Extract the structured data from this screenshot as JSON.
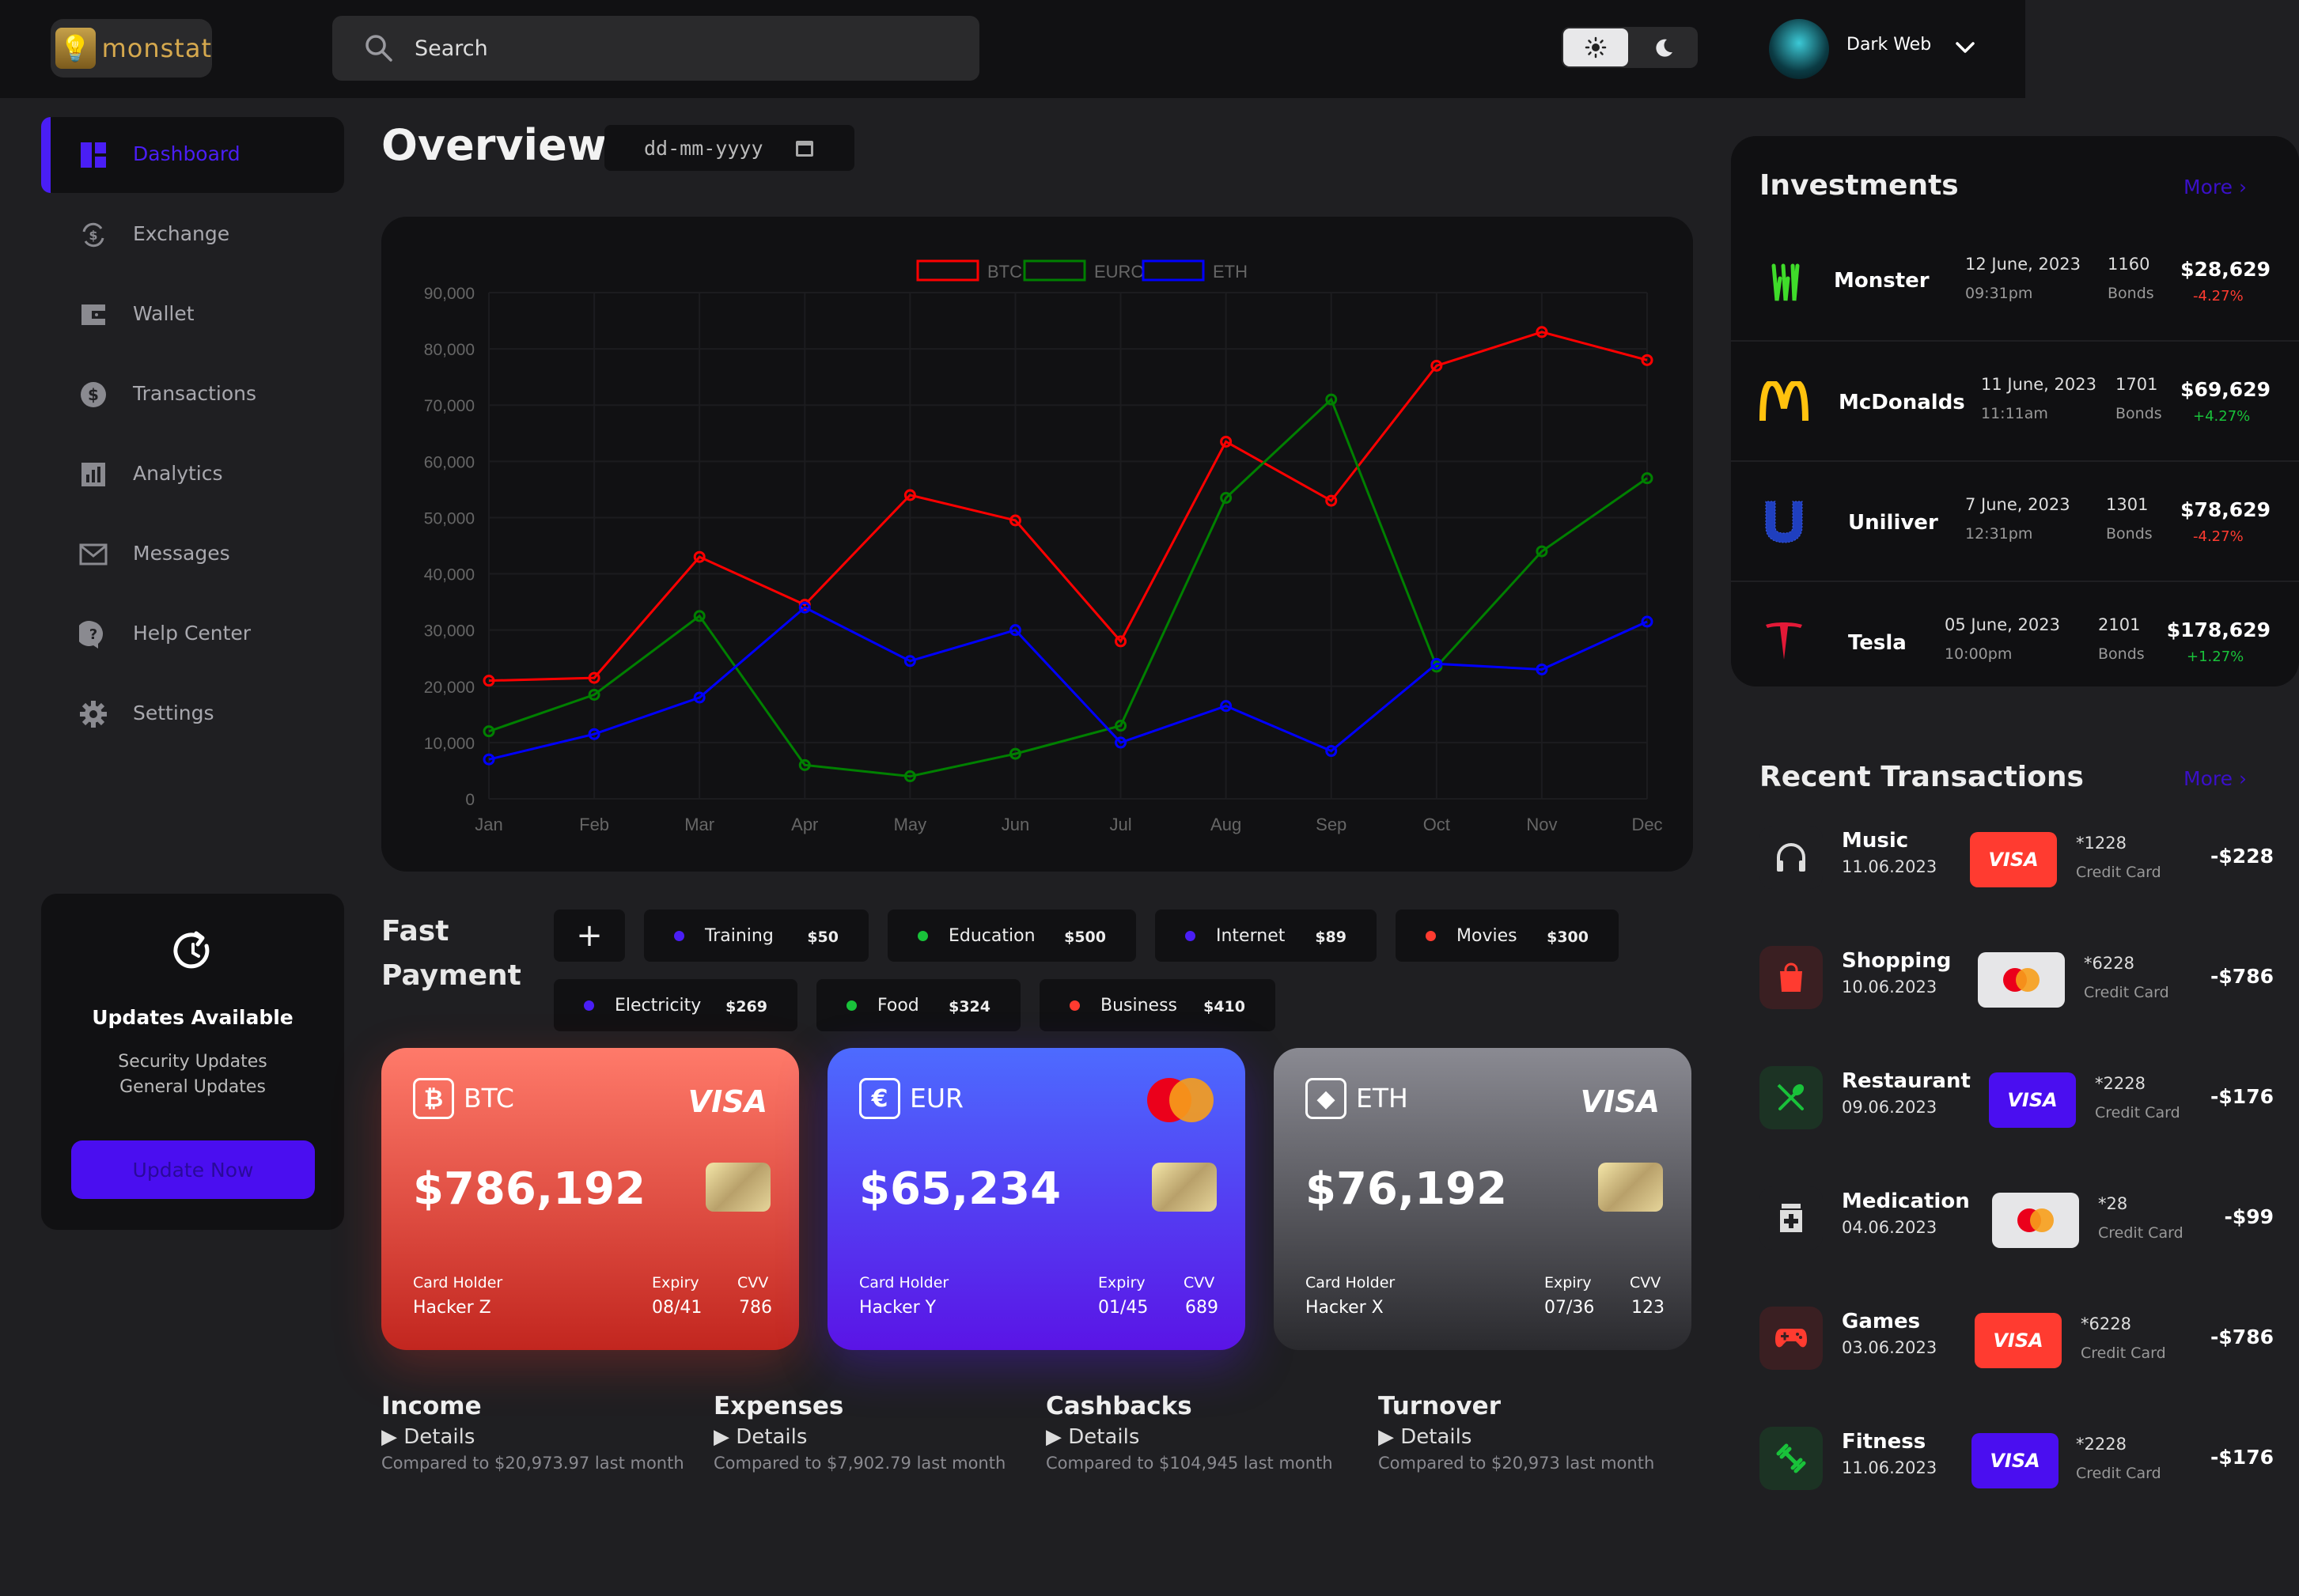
{
  "app": {
    "name": "monstat"
  },
  "search": {
    "placeholder": "Search"
  },
  "user": {
    "name": "Dark Web"
  },
  "theme": {
    "light_icon": "sun-icon",
    "dark_icon": "moon-icon"
  },
  "sidebar": {
    "items": [
      {
        "label": "Dashboard",
        "icon": "dashboard-icon",
        "active": true
      },
      {
        "label": "Exchange",
        "icon": "exchange-icon"
      },
      {
        "label": "Wallet",
        "icon": "wallet-icon"
      },
      {
        "label": "Transactions",
        "icon": "dollar-icon"
      },
      {
        "label": "Analytics",
        "icon": "analytics-icon"
      },
      {
        "label": "Messages",
        "icon": "mail-icon"
      },
      {
        "label": "Help Center",
        "icon": "help-icon"
      },
      {
        "label": "Settings",
        "icon": "gear-icon"
      }
    ],
    "updates": {
      "title": "Updates Available",
      "line1": "Security Updates",
      "line2": "General Updates",
      "button": "Update Now"
    }
  },
  "overview": {
    "title": "Overview",
    "date_placeholder": "dd-mm-yyyy"
  },
  "chart_data": {
    "type": "line",
    "x": [
      "Jan",
      "Feb",
      "Mar",
      "Apr",
      "May",
      "Jun",
      "Jul",
      "Aug",
      "Sep",
      "Oct",
      "Nov",
      "Dec"
    ],
    "ylim": [
      0,
      90000
    ],
    "yticks": [
      "0",
      "10,000",
      "20,000",
      "30,000",
      "40,000",
      "50,000",
      "60,000",
      "70,000",
      "80,000",
      "90,000"
    ],
    "legend": "top-center",
    "series": [
      {
        "name": "BTC",
        "color": "#ff0000",
        "values": [
          21000,
          21500,
          43000,
          34500,
          54000,
          49500,
          28000,
          63500,
          53000,
          77000,
          83000,
          78000
        ]
      },
      {
        "name": "EURO",
        "color": "#008000",
        "values": [
          12000,
          18500,
          32500,
          6000,
          4000,
          8000,
          13000,
          53500,
          71000,
          23500,
          44000,
          57000
        ]
      },
      {
        "name": "ETH",
        "color": "#0000ff",
        "values": [
          7000,
          11500,
          18000,
          34000,
          24500,
          30000,
          10000,
          16500,
          8500,
          24000,
          23000,
          31500
        ]
      }
    ]
  },
  "fast_payment": {
    "title_line1": "Fast",
    "title_line2": "Payment",
    "add_label": "+",
    "row1": [
      {
        "name": "Training",
        "amount": "$50",
        "color": "#4a1ef5"
      },
      {
        "name": "Education",
        "amount": "$500",
        "color": "#19c23a"
      },
      {
        "name": "Internet",
        "amount": "$89",
        "color": "#4a1ef5"
      },
      {
        "name": "Movies",
        "amount": "$300",
        "color": "#ff3b30"
      }
    ],
    "row2": [
      {
        "name": "Electricity",
        "amount": "$269",
        "color": "#4a1ef5"
      },
      {
        "name": "Food",
        "amount": "$324",
        "color": "#19c23a"
      },
      {
        "name": "Business",
        "amount": "$410",
        "color": "#ff3b30"
      }
    ]
  },
  "cards": [
    {
      "currency": "BTC",
      "symbol": "₿",
      "balance": "$786,192",
      "brand": "VISA",
      "holder_label": "Card Holder",
      "holder": "Hacker Z",
      "expiry_label": "Expiry",
      "expiry": "08/41",
      "cvv_label": "CVV",
      "cvv": "786"
    },
    {
      "currency": "EUR",
      "symbol": "€",
      "balance": "$65,234",
      "brand": "mastercard",
      "holder_label": "Card Holder",
      "holder": "Hacker Y",
      "expiry_label": "Expiry",
      "expiry": "01/45",
      "cvv_label": "CVV",
      "cvv": "689"
    },
    {
      "currency": "ETH",
      "symbol": "◆",
      "balance": "$76,192",
      "brand": "VISA",
      "holder_label": "Card Holder",
      "holder": "Hacker X",
      "expiry_label": "Expiry",
      "expiry": "07/36",
      "cvv_label": "CVV",
      "cvv": "123"
    }
  ],
  "summaries": [
    {
      "title": "Income",
      "details": "Details",
      "compare": "Compared to $20,973.97 last month"
    },
    {
      "title": "Expenses",
      "details": "Details",
      "compare": "Compared to $7,902.79 last month"
    },
    {
      "title": "Cashbacks",
      "details": "Details",
      "compare": "Compared to $104,945 last month"
    },
    {
      "title": "Turnover",
      "details": "Details",
      "compare": "Compared to $20,973 last month"
    }
  ],
  "investments": {
    "title": "Investments",
    "more": "More",
    "rows": [
      {
        "name": "Monster",
        "date": "12 June, 2023",
        "time": "09:31pm",
        "qty": "1160",
        "unit": "Bonds",
        "amount": "$28,629",
        "change": "-4.27%",
        "change_color": "#ff3b30",
        "logo": "monster-logo-icon"
      },
      {
        "name": "McDonalds",
        "date": "11 June, 2023",
        "time": "11:11am",
        "qty": "1701",
        "unit": "Bonds",
        "amount": "$69,629",
        "change": "+4.27%",
        "change_color": "#19c23a",
        "logo": "mcdonalds-logo-icon"
      },
      {
        "name": "Uniliver",
        "date": "7 June, 2023",
        "time": "12:31pm",
        "qty": "1301",
        "unit": "Bonds",
        "amount": "$78,629",
        "change": "-4.27%",
        "change_color": "#ff3b30",
        "logo": "unilever-logo-icon"
      },
      {
        "name": "Tesla",
        "date": "05 June, 2023",
        "time": "10:00pm",
        "qty": "2101",
        "unit": "Bonds",
        "amount": "$178,629",
        "change": "+1.27%",
        "change_color": "#19c23a",
        "logo": "tesla-logo-icon"
      }
    ]
  },
  "recent_transactions": {
    "title": "Recent Transactions",
    "more": "More",
    "rows": [
      {
        "name": "Music",
        "date": "11.06.2023",
        "card": "VISA",
        "card_color": "#ff3b30",
        "number": "*1228",
        "type": "Credit Card",
        "amount": "-$228",
        "icon": "headphones-icon",
        "icon_bg": "#1f1f22"
      },
      {
        "name": "Shopping",
        "date": "10.06.2023",
        "card": "mastercard",
        "card_color": "#e6e6e8",
        "number": "*6228",
        "type": "Credit Card",
        "amount": "-$786",
        "icon": "shopping-bag-icon",
        "icon_bg": "#3a1f22"
      },
      {
        "name": "Restaurant",
        "date": "09.06.2023",
        "card": "VISA",
        "card_color": "#4a0ef0",
        "number": "*2228",
        "type": "Credit Card",
        "amount": "-$176",
        "icon": "utensils-icon",
        "icon_bg": "#1c3324"
      },
      {
        "name": "Medication",
        "date": "04.06.2023",
        "card": "mastercard",
        "card_color": "#e6e6e8",
        "number": "*28",
        "type": "Credit Card",
        "amount": "-$99",
        "icon": "medicine-icon",
        "icon_bg": "#1f1f22"
      },
      {
        "name": "Games",
        "date": "03.06.2023",
        "card": "VISA",
        "card_color": "#ff3b30",
        "number": "*6228",
        "type": "Credit Card",
        "amount": "-$786",
        "icon": "gamepad-icon",
        "icon_bg": "#3a1f22"
      },
      {
        "name": "Fitness",
        "date": "11.06.2023",
        "card": "VISA",
        "card_color": "#4a0ef0",
        "number": "*2228",
        "type": "Credit Card",
        "amount": "-$176",
        "icon": "dumbbell-icon",
        "icon_bg": "#1c3324"
      }
    ]
  }
}
